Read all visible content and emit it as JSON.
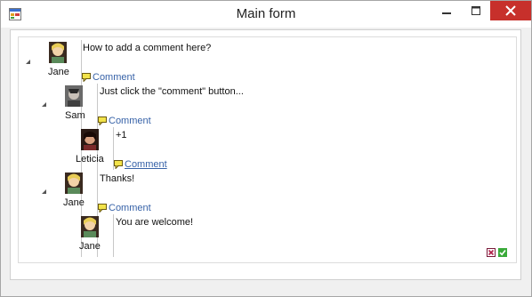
{
  "window": {
    "title": "Main form",
    "colors": {
      "close_button": "#c7302b",
      "link": "#3863a8"
    }
  },
  "comments": [
    {
      "author": "Jane",
      "text": "How to add a comment here?",
      "reply_label": "Comment"
    },
    {
      "author": "Sam",
      "text": "Just click the \"comment\" button...",
      "reply_label": "Comment"
    },
    {
      "author": "Leticia",
      "text": "+1",
      "reply_label": "Comment"
    },
    {
      "author": "Jane",
      "text": "Thanks!",
      "reply_label": "Comment"
    },
    {
      "author": "Jane",
      "text": "You are welcome!"
    }
  ],
  "actions": {
    "cancel_icon": "cancel-icon",
    "confirm_icon": "confirm-icon"
  }
}
